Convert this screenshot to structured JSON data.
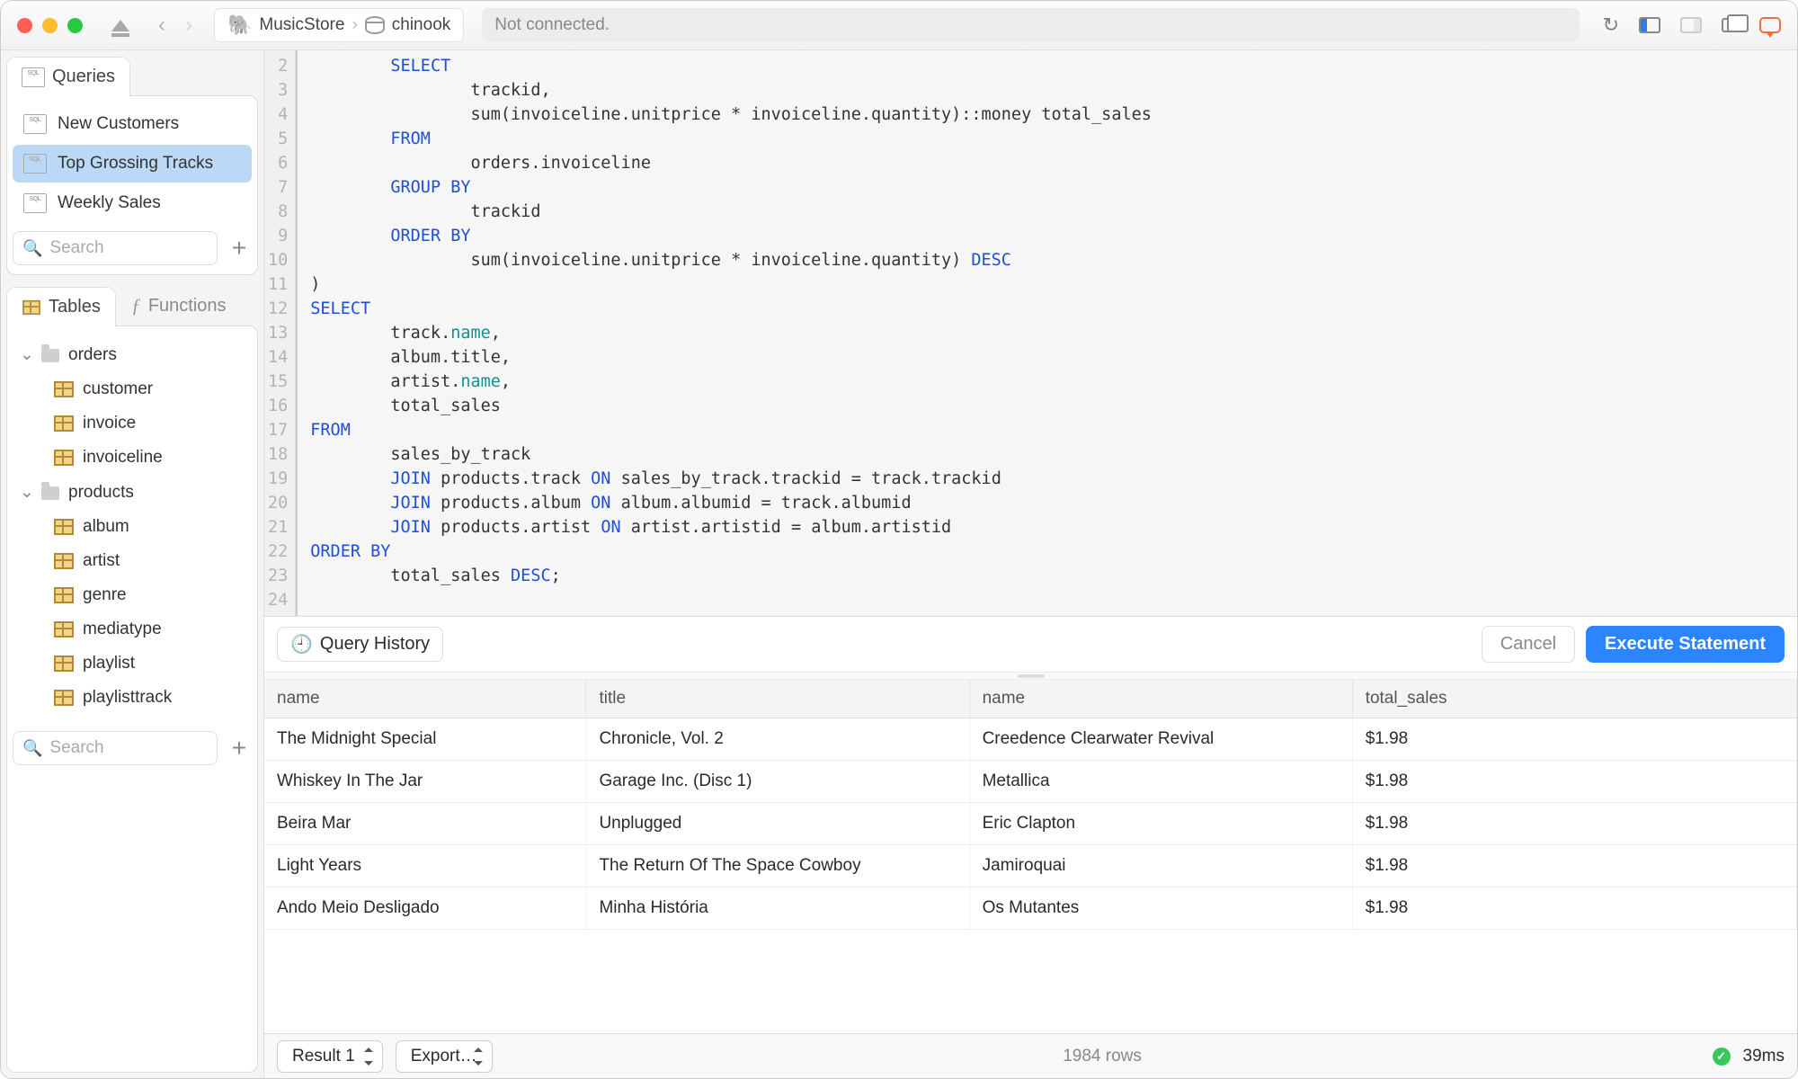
{
  "titlebar": {
    "project": "MusicStore",
    "database": "chinook",
    "status": "Not connected."
  },
  "sidebar": {
    "queries_tab": "Queries",
    "tables_tab": "Tables",
    "functions_tab": "Functions",
    "search_placeholder": "Search",
    "queries": [
      {
        "label": "New Customers",
        "selected": false
      },
      {
        "label": "Top Grossing Tracks",
        "selected": true
      },
      {
        "label": "Weekly Sales",
        "selected": false
      }
    ],
    "schemas": [
      {
        "name": "orders",
        "tables": [
          "customer",
          "invoice",
          "invoiceline"
        ]
      },
      {
        "name": "products",
        "tables": [
          "album",
          "artist",
          "genre",
          "mediatype",
          "playlist",
          "playlisttrack"
        ]
      }
    ]
  },
  "editor": {
    "first_line_no": 2,
    "lines": [
      {
        "indent": 2,
        "tokens": [
          [
            "kw",
            "SELECT"
          ]
        ]
      },
      {
        "indent": 4,
        "tokens": [
          [
            "",
            "trackid,"
          ]
        ]
      },
      {
        "indent": 4,
        "tokens": [
          [
            "",
            "sum(invoiceline.unitprice * invoiceline.quantity)::money total_sales"
          ]
        ]
      },
      {
        "indent": 2,
        "tokens": [
          [
            "kw",
            "FROM"
          ]
        ]
      },
      {
        "indent": 4,
        "tokens": [
          [
            "",
            "orders.invoiceline"
          ]
        ]
      },
      {
        "indent": 2,
        "tokens": [
          [
            "kw",
            "GROUP BY"
          ]
        ]
      },
      {
        "indent": 4,
        "tokens": [
          [
            "",
            "trackid"
          ]
        ]
      },
      {
        "indent": 2,
        "tokens": [
          [
            "kw",
            "ORDER BY"
          ]
        ]
      },
      {
        "indent": 4,
        "tokens": [
          [
            "",
            "sum(invoiceline.unitprice * invoiceline.quantity) "
          ],
          [
            "kw",
            "DESC"
          ]
        ]
      },
      {
        "indent": 0,
        "tokens": [
          [
            "",
            ")"
          ]
        ]
      },
      {
        "indent": 0,
        "tokens": [
          [
            "kw",
            "SELECT"
          ]
        ]
      },
      {
        "indent": 2,
        "tokens": [
          [
            "",
            "track."
          ],
          [
            "id",
            "name"
          ],
          [
            "",
            ","
          ]
        ]
      },
      {
        "indent": 2,
        "tokens": [
          [
            "",
            "album.title,"
          ]
        ]
      },
      {
        "indent": 2,
        "tokens": [
          [
            "",
            "artist."
          ],
          [
            "id",
            "name"
          ],
          [
            "",
            ","
          ]
        ]
      },
      {
        "indent": 2,
        "tokens": [
          [
            "",
            "total_sales"
          ]
        ]
      },
      {
        "indent": 0,
        "tokens": [
          [
            "kw",
            "FROM"
          ]
        ]
      },
      {
        "indent": 2,
        "tokens": [
          [
            "",
            "sales_by_track"
          ]
        ]
      },
      {
        "indent": 2,
        "tokens": [
          [
            "kw",
            "JOIN"
          ],
          [
            "",
            " products.track "
          ],
          [
            "kw",
            "ON"
          ],
          [
            "",
            " sales_by_track.trackid = track.trackid"
          ]
        ]
      },
      {
        "indent": 2,
        "tokens": [
          [
            "kw",
            "JOIN"
          ],
          [
            "",
            " products.album "
          ],
          [
            "kw",
            "ON"
          ],
          [
            "",
            " album.albumid = track.albumid"
          ]
        ]
      },
      {
        "indent": 2,
        "tokens": [
          [
            "kw",
            "JOIN"
          ],
          [
            "",
            " products.artist "
          ],
          [
            "kw",
            "ON"
          ],
          [
            "",
            " artist.artistid = album.artistid"
          ]
        ]
      },
      {
        "indent": 0,
        "tokens": [
          [
            "kw",
            "ORDER BY"
          ]
        ]
      },
      {
        "indent": 2,
        "tokens": [
          [
            "",
            "total_sales "
          ],
          [
            "kw",
            "DESC"
          ],
          [
            "",
            ";"
          ]
        ]
      },
      {
        "indent": 0,
        "tokens": [
          [
            "",
            ""
          ]
        ]
      }
    ]
  },
  "runbar": {
    "history": "Query History",
    "cancel": "Cancel",
    "execute": "Execute Statement"
  },
  "results": {
    "columns": [
      "name",
      "title",
      "name",
      "total_sales"
    ],
    "rows": [
      [
        "The Midnight Special",
        "Chronicle, Vol. 2",
        "Creedence Clearwater Revival",
        "$1.98"
      ],
      [
        "Whiskey In The Jar",
        "Garage Inc. (Disc 1)",
        "Metallica",
        "$1.98"
      ],
      [
        "Beira Mar",
        "Unplugged",
        "Eric Clapton",
        "$1.98"
      ],
      [
        "Light Years",
        "The Return Of The Space Cowboy",
        "Jamiroquai",
        "$1.98"
      ],
      [
        "Ando Meio Desligado",
        "Minha História",
        "Os Mutantes",
        "$1.98"
      ]
    ]
  },
  "footer": {
    "result_label": "Result 1",
    "export": "Export…",
    "rowcount": "1984 rows",
    "time": "39ms"
  }
}
